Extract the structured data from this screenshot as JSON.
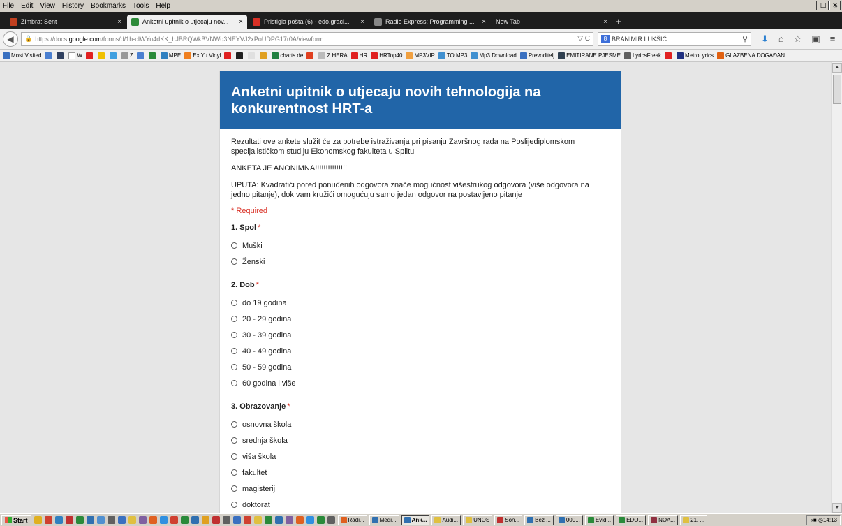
{
  "menu": [
    "File",
    "Edit",
    "View",
    "History",
    "Bookmarks",
    "Tools",
    "Help"
  ],
  "window_controls": [
    "_",
    "□",
    "×"
  ],
  "tabs": [
    {
      "label": "Zimbra: Sent",
      "color": "#c04020",
      "active": false
    },
    {
      "label": "Anketni upitnik o utjecaju nov...",
      "color": "#2e8b3a",
      "active": true
    },
    {
      "label": "Pristigla pošta (6) - edo.graci...",
      "color": "#d93025",
      "active": false
    },
    {
      "label": "Radio Express: Programming ...",
      "color": "#888888",
      "active": false
    },
    {
      "label": "New Tab",
      "color": "",
      "active": false
    }
  ],
  "nav": {
    "url_prefix": "https://docs.",
    "url_host": "google.com",
    "url_rest": "/forms/d/1h-cIWYu4dKK_hJBRQWkBVNWq3NEYVJ2xPoUDPG17r0A/viewform",
    "url_tools": "▽ C",
    "search_engine": "8",
    "search_text": "BRANIMIR LUKŠIĆ"
  },
  "bookmarks": [
    {
      "label": "Most Visited",
      "color": "#3a70c0"
    },
    {
      "label": "",
      "color": "#4a7fd0"
    },
    {
      "label": "",
      "color": "#304060"
    },
    {
      "label": "W",
      "color": "#ffffff"
    },
    {
      "label": "",
      "color": "#e02020"
    },
    {
      "label": "",
      "color": "#f0c000"
    },
    {
      "label": "",
      "color": "#40a0e0"
    },
    {
      "label": "Z",
      "color": "#999999"
    },
    {
      "label": "",
      "color": "#4a7fd0"
    },
    {
      "label": "",
      "color": "#2a8a3a"
    },
    {
      "label": "MPE",
      "color": "#3080c0"
    },
    {
      "label": "Ex Yu Vinyl",
      "color": "#f08020"
    },
    {
      "label": "",
      "color": "#e02020"
    },
    {
      "label": "",
      "color": "#202020"
    },
    {
      "label": "",
      "color": "#e0e0e0"
    },
    {
      "label": "",
      "color": "#e0a020"
    },
    {
      "label": "charts.de",
      "color": "#208040"
    },
    {
      "label": "",
      "color": "#e04020"
    },
    {
      "label": "Z HERA",
      "color": "#bbbbbb"
    },
    {
      "label": "HR",
      "color": "#e02020"
    },
    {
      "label": "HRTop40",
      "color": "#e02020"
    },
    {
      "label": "MP3VIP",
      "color": "#f0a040"
    },
    {
      "label": "TO MP3",
      "color": "#4090d0"
    },
    {
      "label": "Mp3 Download",
      "color": "#4090d0"
    },
    {
      "label": "Prevoditelj",
      "color": "#3a70c0"
    },
    {
      "label": "EMITIRANE PJESME",
      "color": "#304050"
    },
    {
      "label": "LyricsFreak",
      "color": "#606060"
    },
    {
      "label": "",
      "color": "#e02020"
    },
    {
      "label": "MetroLyrics",
      "color": "#203080"
    },
    {
      "label": "GLAZBENA DOGAĐAN...",
      "color": "#e06010"
    }
  ],
  "form": {
    "title": "Anketni upitnik o utjecaju novih tehnologija na konkurentnost HRT-a",
    "description": "Rezultati ove ankete služit će za potrebe istraživanja pri pisanju Završnog rada na Poslijediplomskom specijalističkom studiju Ekonomskog fakulteta u Splitu",
    "anonymous_note": "ANKETA JE ANONIMNA!!!!!!!!!!!!!!!",
    "instructions": "UPUTA: Kvadratići pored ponuđenih odgovora znače mogućnost višestrukog odgovora (više odgovora na jedno pitanje), dok vam kružići omogućuju samo jedan odgovor na postavljeno pitanje",
    "required_note": "* Required",
    "required_mark": "*",
    "questions": [
      {
        "title": "1. Spol",
        "options": [
          "Muški",
          "Ženski"
        ]
      },
      {
        "title": "2. Dob",
        "options": [
          "do 19 godina",
          "20 - 29 godina",
          "30 - 39 godina",
          "40 - 49 godina",
          "50 - 59 godina",
          "60 godina i više"
        ]
      },
      {
        "title": "3. Obrazovanje",
        "options": [
          "osnovna škola",
          "srednja škola",
          "viša škola",
          "fakultet",
          "magisterij",
          "doktorat"
        ]
      }
    ]
  },
  "taskbar": {
    "start_label": "Start",
    "tasks": [
      {
        "label": "Radi...",
        "color": "#e06020",
        "active": false
      },
      {
        "label": "Medi...",
        "color": "#3070b0",
        "active": false
      },
      {
        "label": "Ank...",
        "color": "#3070b0",
        "active": true
      },
      {
        "label": "Audi...",
        "color": "#e0c040",
        "active": false
      },
      {
        "label": "UNOS",
        "color": "#e0c040",
        "active": false
      },
      {
        "label": "Son...",
        "color": "#c03030",
        "active": false
      },
      {
        "label": "Bez ...",
        "color": "#3070b0",
        "active": false
      },
      {
        "label": "000...",
        "color": "#3070b0",
        "active": false
      },
      {
        "label": "Evid...",
        "color": "#2a8a3a",
        "active": false
      },
      {
        "label": "EDO...",
        "color": "#2a8a3a",
        "active": false
      },
      {
        "label": "NOA...",
        "color": "#903040",
        "active": false
      },
      {
        "label": "21. ...",
        "color": "#e0c040",
        "active": false
      }
    ],
    "clock": "14:13",
    "tray_prefix": "«"
  }
}
